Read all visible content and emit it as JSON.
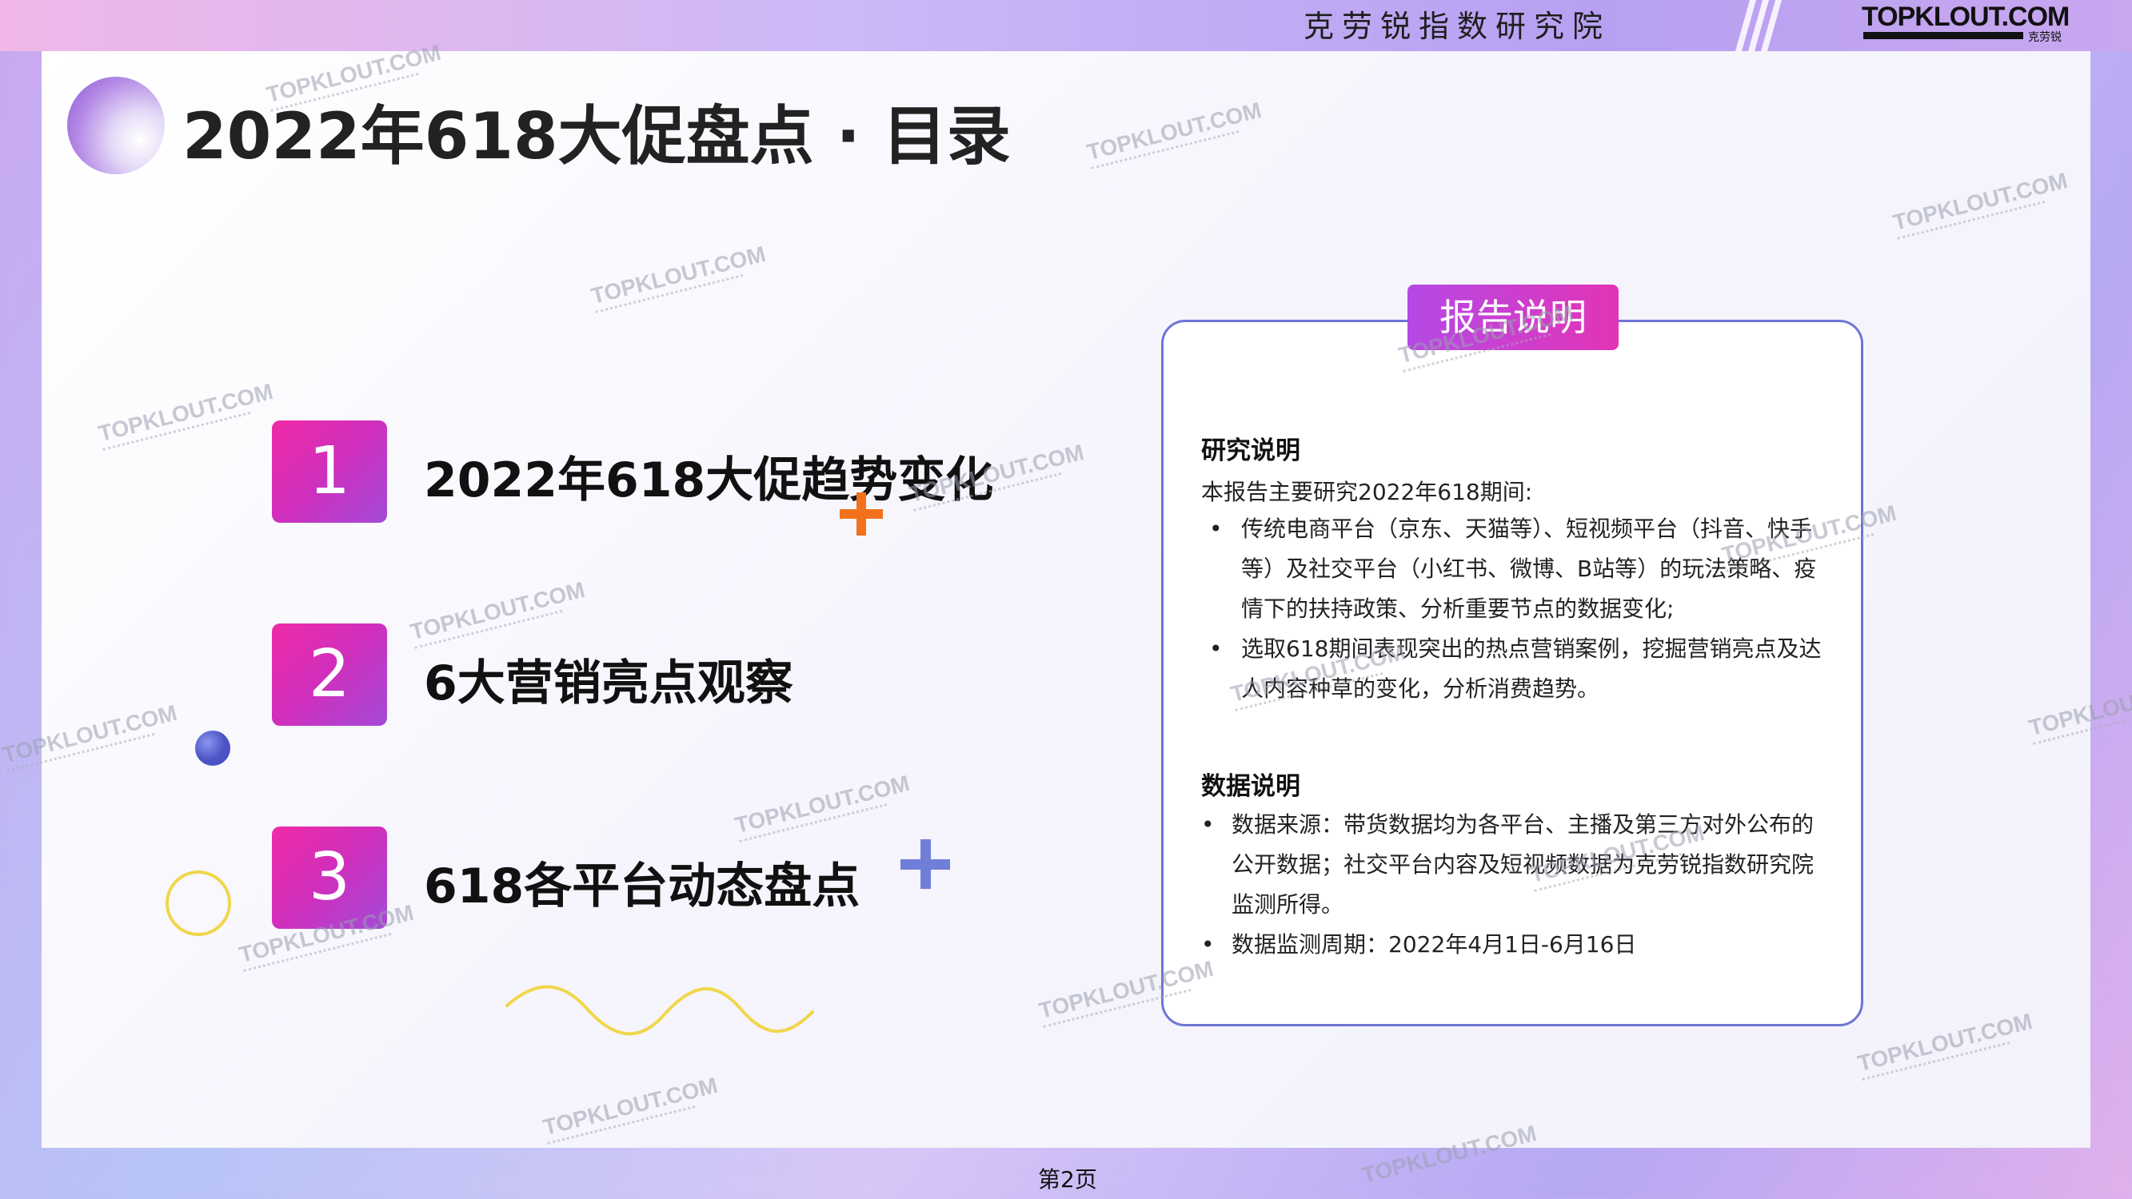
{
  "header": {
    "institute": "克劳锐指数研究院",
    "logo": "TOPKLOUT.COM",
    "logo_sub": "克劳锐"
  },
  "title": "2022年618大促盘点 · 目录",
  "toc": [
    {
      "num": "1",
      "text": "2022年618大促趋势变化"
    },
    {
      "num": "2",
      "text": "6大营销亮点观察"
    },
    {
      "num": "3",
      "text": "618各平台动态盘点"
    }
  ],
  "card": {
    "tab": "报告说明",
    "research": {
      "heading": "研究说明",
      "intro": "本报告主要研究2022年618期间:",
      "bullets": [
        [
          "传统电商平台（京东、天猫等）、短视频平台（抖音、快手",
          "等）及社交平台（小红书、微博、B站等）的玩法策略、疫",
          "情下的扶持政策、分析重要节点的数据变化;"
        ],
        [
          "选取618期间表现突出的热点营销案例，挖掘营销亮点及达",
          "人内容种草的变化，分析消费趋势。"
        ]
      ]
    },
    "data": {
      "heading": "数据说明",
      "bullets": [
        [
          "数据来源：带货数据均为各平台、主播及第三方对外公布的",
          "公开数据；社交平台内容及短视频数据为克劳锐指数研究院",
          "监测所得。"
        ],
        [
          "数据监测周期：2022年4月1日-6月16日"
        ]
      ]
    }
  },
  "bullet_symbol": "•",
  "footer": {
    "page": "第2页"
  },
  "watermark": "TOPKLOUT.COM",
  "colors": {
    "accent_pink": "#e234b6",
    "accent_purple": "#a34ad8",
    "card_border": "#6f74d6",
    "plus_orange": "#f2711c",
    "plus_blue": "#6f7fd8",
    "dot_blue": "#5661cf",
    "ring_yellow": "#f0d64a"
  }
}
